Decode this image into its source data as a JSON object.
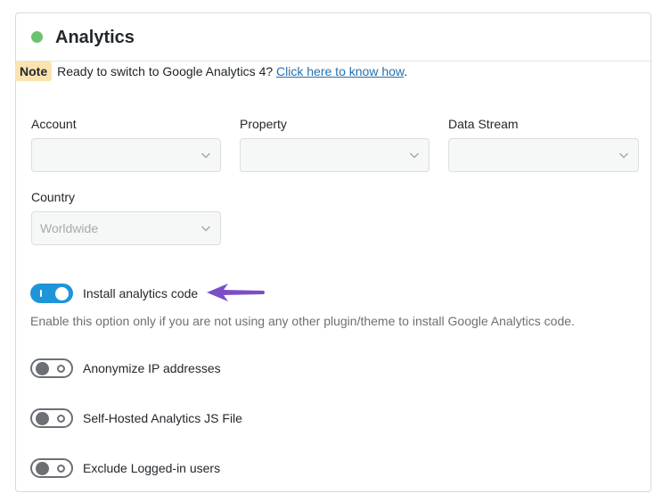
{
  "header": {
    "title": "Analytics",
    "status_color": "#6dc26f"
  },
  "note": {
    "badge": "Note",
    "text": "Ready to switch to Google Analytics 4? ",
    "link": "Click here to know how",
    "after_link": "."
  },
  "fields": {
    "account": {
      "label": "Account",
      "value": ""
    },
    "property": {
      "label": "Property",
      "value": ""
    },
    "data_stream": {
      "label": "Data Stream",
      "value": ""
    },
    "country": {
      "label": "Country",
      "value": "Worldwide"
    }
  },
  "toggles": {
    "install_code": {
      "label": "Install analytics code",
      "state": "on",
      "help": "Enable this option only if you are not using any other plugin/theme to install Google Analytics code."
    },
    "anonymize_ip": {
      "label": "Anonymize IP addresses",
      "state": "off"
    },
    "self_hosted": {
      "label": "Self-Hosted Analytics JS File",
      "state": "off"
    },
    "exclude_logged": {
      "label": "Exclude Logged-in users",
      "state": "off"
    }
  },
  "colors": {
    "toggle_on": "#1f95d9",
    "annotation_arrow": "#7b4ec8",
    "link": "#2271b1"
  },
  "icons": {
    "select_caret": "chevron-down-icon",
    "annotation": "arrow-left-icon"
  }
}
